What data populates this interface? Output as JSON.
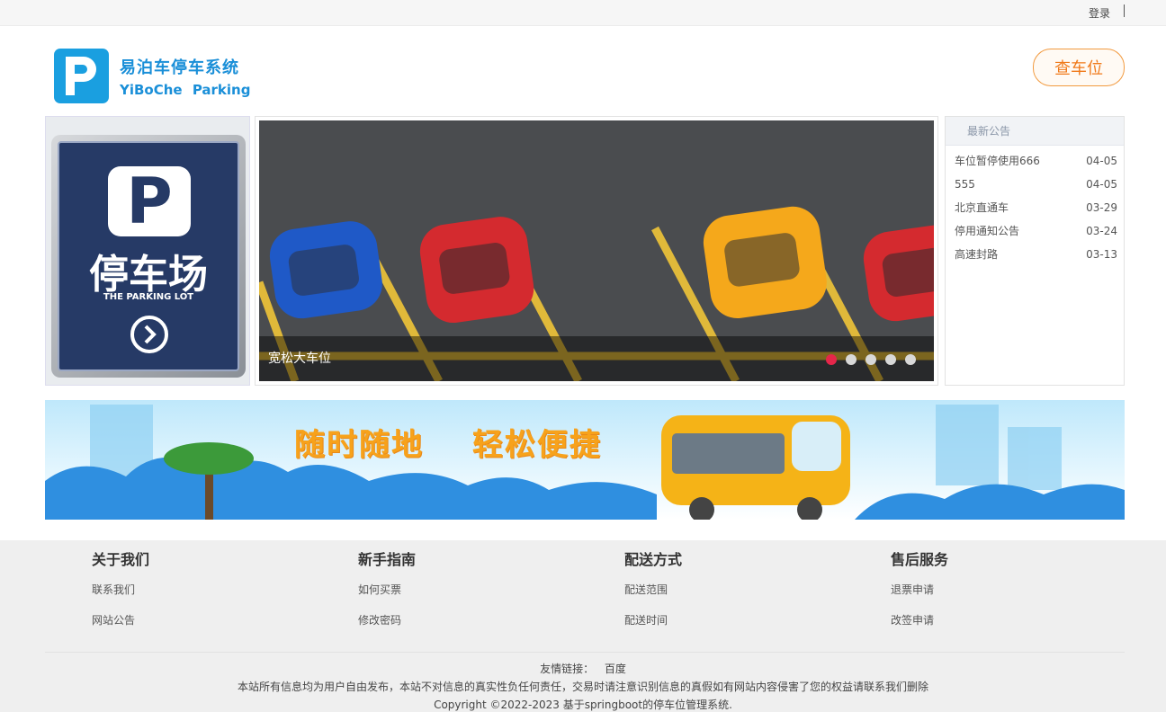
{
  "topbar": {
    "login": "登录"
  },
  "header": {
    "logo_cn": "易泊车停车系统",
    "logo_en": "YiBoChe Parking",
    "find_button": "查车位"
  },
  "sign": {
    "cn": "停车场",
    "en": "THE PARKING LOT",
    "letter": "P"
  },
  "carousel": {
    "caption": "宽松大车位",
    "slide_count": 5,
    "active_index": 0
  },
  "notice": {
    "title": "最新公告",
    "items": [
      {
        "title": "车位暂停使用666",
        "date": "04-05"
      },
      {
        "title": "555",
        "date": "04-05"
      },
      {
        "title": "北京直通车",
        "date": "03-29"
      },
      {
        "title": "停用通知公告",
        "date": "03-24"
      },
      {
        "title": "高速封路",
        "date": "03-13"
      }
    ]
  },
  "banner": {
    "text": "随时随地 轻松便捷"
  },
  "footer": {
    "columns": [
      {
        "title": "关于我们",
        "links": [
          "联系我们",
          "网站公告"
        ]
      },
      {
        "title": "新手指南",
        "links": [
          "如何买票",
          "修改密码"
        ]
      },
      {
        "title": "配送方式",
        "links": [
          "配送范围",
          "配送时间"
        ]
      },
      {
        "title": "售后服务",
        "links": [
          "退票申请",
          "改签申请"
        ]
      }
    ],
    "friend_label": "友情链接：",
    "friend_link": "百度",
    "disclaimer": "本站所有信息均为用户自由发布，本站不对信息的真实性负任何责任，交易时请注意识别信息的真假如有网站内容侵害了您的权益请联系我们删除",
    "copyright": "Copyright ©2022-2023 基于springboot的停车位管理系统."
  },
  "colors": {
    "brand": "#1a9fe0",
    "accent": "#f07a1a",
    "dot_active": "#e5264a"
  }
}
